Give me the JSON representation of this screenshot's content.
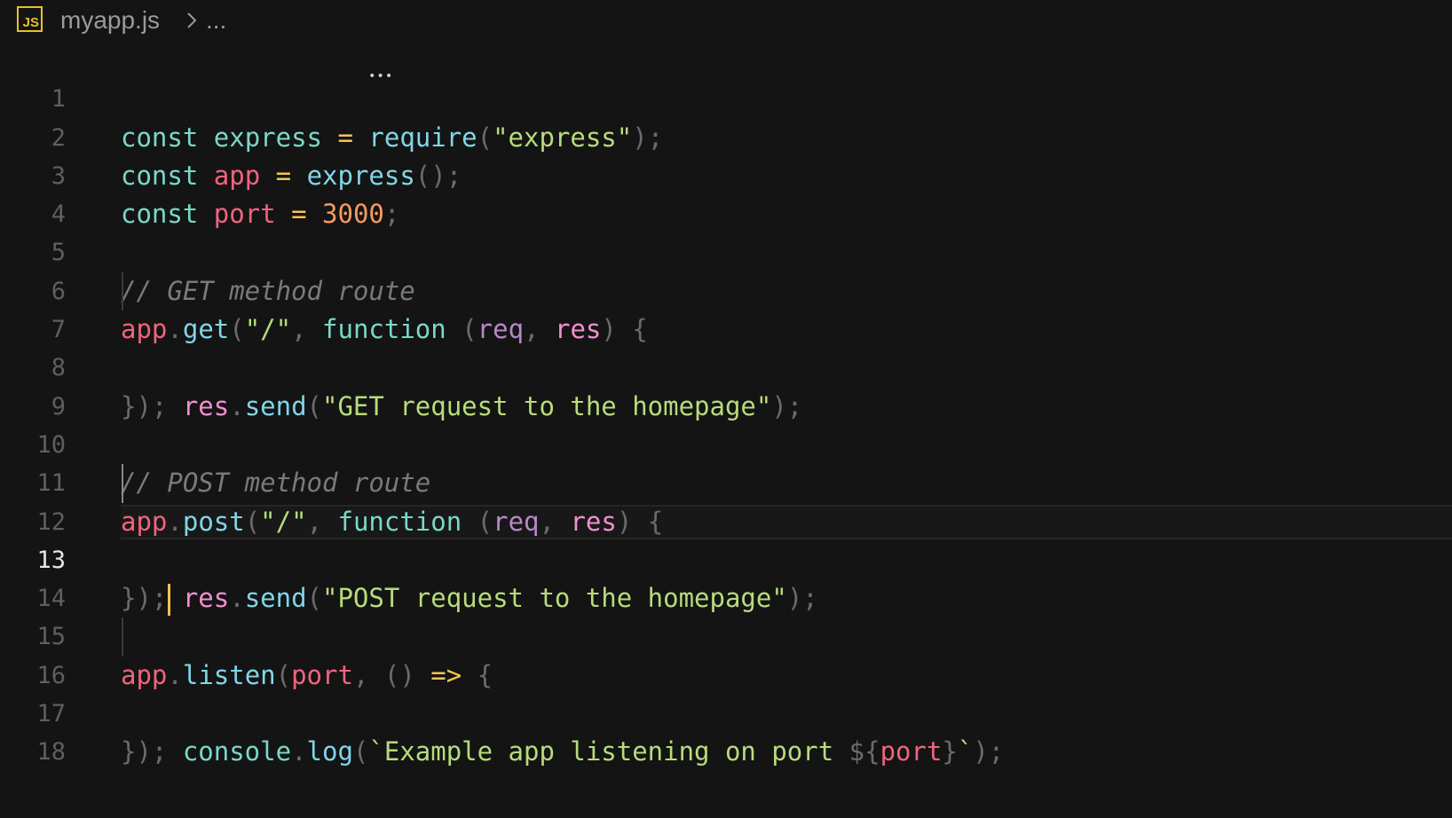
{
  "breadcrumb": {
    "icon_label": "JS",
    "file_name": "myapp.js",
    "more": "..."
  },
  "editor": {
    "current_line": 13,
    "lines": [
      {
        "number": "1",
        "text": "const express = require(\"express\");"
      },
      {
        "number": "2",
        "text": "const app = express();"
      },
      {
        "number": "3",
        "text": "const port = 3000;"
      },
      {
        "number": "4",
        "text": ""
      },
      {
        "number": "5",
        "text": "// GET method route"
      },
      {
        "number": "6",
        "text": "app.get(\"/\", function (req, res) {"
      },
      {
        "number": "7",
        "text": "    res.send(\"GET request to the homepage\");"
      },
      {
        "number": "8",
        "text": "});"
      },
      {
        "number": "9",
        "text": ""
      },
      {
        "number": "10",
        "text": "// POST method route"
      },
      {
        "number": "11",
        "text": "app.post(\"/\", function (req, res) {"
      },
      {
        "number": "12",
        "text": "    res.send(\"POST request to the homepage\");"
      },
      {
        "number": "13",
        "text": "});"
      },
      {
        "number": "14",
        "text": ""
      },
      {
        "number": "15",
        "text": "app.listen(port, () => {"
      },
      {
        "number": "16",
        "text": "    console.log(`Example app listening on port ${port}`);"
      },
      {
        "number": "17",
        "text": "});"
      },
      {
        "number": "18",
        "text": ""
      }
    ]
  },
  "colors": {
    "background": "#141414",
    "keyword": "#79d8c8",
    "variable": "#f2637e",
    "operator": "#f6c453",
    "string": "#b7dc7b",
    "number": "#f79a5e",
    "comment": "#7a7a7a",
    "cursor": "#f2c14e",
    "js_icon": "#e8c02a"
  }
}
